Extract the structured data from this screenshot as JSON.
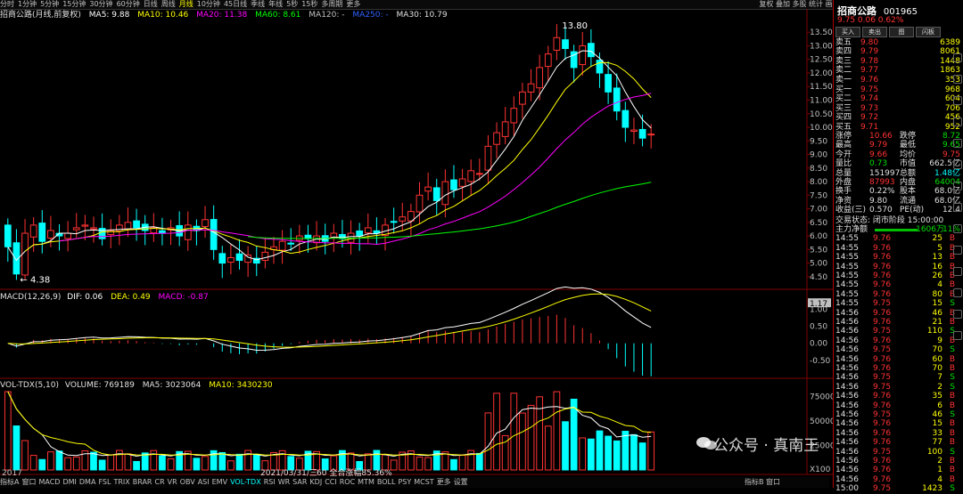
{
  "toolbar": {
    "periods": [
      "分时",
      "1分钟",
      "5分钟",
      "15分钟",
      "30分钟",
      "60分钟",
      "日线",
      "周线",
      "月线",
      "10分钟",
      "45日线",
      "季线",
      "年线",
      "5秒",
      "15秒",
      "多周期",
      "更多"
    ],
    "active_period": "月线",
    "right_items": "复权 叠加 多股 统计 画线 F10 标记 返回"
  },
  "chart_info": {
    "name": "招商公路(月线,前复权)",
    "ma5": "MA5: 9.88",
    "ma10": "MA10: 10.46",
    "ma20": "MA20: 11.38",
    "ma60": "MA60: 8.61",
    "ma120": "MA120: -",
    "ma250": "MA250: -",
    "ma30": "MA30: 10.79"
  },
  "price_axis": [
    "13.50",
    "13.00",
    "12.50",
    "12.00",
    "11.50",
    "11.00",
    "10.50",
    "10.00",
    "9.50",
    "9.00",
    "8.50",
    "8.00",
    "7.50",
    "7.00",
    "6.50",
    "6.00",
    "5.50",
    "5.00",
    "4.50"
  ],
  "annotations": {
    "high": "13.80",
    "low": "4.38"
  },
  "macd_info": {
    "label": "MACD(12,26,9)",
    "dif": "DIF: 0.06",
    "dea": "DEA: 0.49",
    "macd": "MACD: -0.87"
  },
  "macd_axis": [
    "1.17",
    "1.00",
    "0.50",
    "0.00",
    "-0.50"
  ],
  "vol_info": {
    "label": "VOL-TDX(5,10)",
    "volume": "VOLUME: 769189",
    "ma5": "MA5: 3023064",
    "ma10": "MA10: 3430230"
  },
  "vol_axis": [
    "75000",
    "50000",
    "25000",
    "X100"
  ],
  "time_axis": {
    "start": "2017",
    "mid": "2021/03/31/三",
    "overlay": "60 全合涨幅85.36%"
  },
  "bottom_tabs": [
    "指标A",
    "窗口",
    "MACD",
    "DMI",
    "DMA",
    "FSL",
    "TRIX",
    "BRAR",
    "CR",
    "VR",
    "OBV",
    "ASI",
    "EMV",
    "VOL-TDX",
    "RSI",
    "WR",
    "SAR",
    "KDJ",
    "CCI",
    "ROC",
    "MTM",
    "BOLL",
    "PSY",
    "MCST",
    "更多",
    "设置"
  ],
  "bottom_active": "VOL-TDX",
  "bottom_right": "指标B 窗口",
  "stock": {
    "name": "招商公路",
    "code": "001965",
    "price_line": "9.75  0.06  0.62%"
  },
  "trade_buttons": [
    "买入",
    "卖出",
    "图",
    "闪板"
  ],
  "order_book": [
    {
      "label": "卖五",
      "price": "9.80",
      "vol": "6389",
      "c": "red"
    },
    {
      "label": "卖四",
      "price": "9.79",
      "vol": "8061",
      "c": "red"
    },
    {
      "label": "卖三",
      "price": "9.78",
      "vol": "1448",
      "c": "red"
    },
    {
      "label": "卖二",
      "price": "9.77",
      "vol": "1863",
      "c": "red"
    },
    {
      "label": "卖一",
      "price": "9.76",
      "vol": "353",
      "c": "red"
    },
    {
      "label": "买一",
      "price": "9.75",
      "vol": "968",
      "c": "red"
    },
    {
      "label": "买二",
      "price": "9.74",
      "vol": "604",
      "c": "red"
    },
    {
      "label": "买三",
      "price": "9.73",
      "vol": "706",
      "c": "red"
    },
    {
      "label": "买四",
      "price": "9.72",
      "vol": "456",
      "c": "red"
    },
    {
      "label": "买五",
      "price": "9.71",
      "vol": "952",
      "c": "red"
    }
  ],
  "quote": [
    {
      "l1": "涨停",
      "v1": "10.66",
      "c1": "red",
      "l2": "跌停",
      "v2": "8.72",
      "c2": "green"
    },
    {
      "l1": "最高",
      "v1": "9.79",
      "c1": "red",
      "l2": "最低",
      "v2": "9.65",
      "c2": "green"
    },
    {
      "l1": "今开",
      "v1": "9.66",
      "c1": "red",
      "l2": "均价",
      "v2": "9.75",
      "c2": "red"
    },
    {
      "l1": "量比",
      "v1": "0.73",
      "c1": "green",
      "l2": "市值",
      "v2": "662.5亿",
      "c2": "white"
    },
    {
      "l1": "总量",
      "v1": "151997",
      "c1": "white",
      "l2": "总额",
      "v2": "1.48亿",
      "c2": "cyan"
    },
    {
      "l1": "外盘",
      "v1": "87993",
      "c1": "red",
      "l2": "内盘",
      "v2": "64004",
      "c2": "green"
    },
    {
      "l1": "换手",
      "v1": "0.22%",
      "c1": "white",
      "l2": "股本",
      "v2": "68.0亿",
      "c2": "white"
    },
    {
      "l1": "净资",
      "v1": "9.80",
      "c1": "white",
      "l2": "流通",
      "v2": "68.0亿",
      "c2": "white"
    },
    {
      "l1": "收益(三)",
      "v1": "0.570",
      "c1": "white",
      "l2": "PE(动)",
      "v2": "12.4",
      "c2": "white"
    }
  ],
  "status_line": "交易状态: 闭市阶段 15:00:00",
  "main_flow": {
    "label": "主力净额",
    "value": "-1606万",
    "pct": "11%"
  },
  "ticks": [
    {
      "t": "14:55",
      "p": "9.76",
      "v": "25",
      "d": "B"
    },
    {
      "t": "14:55",
      "p": "9.76",
      "v": "5",
      "d": "B"
    },
    {
      "t": "14:55",
      "p": "9.76",
      "v": "13",
      "d": "B"
    },
    {
      "t": "14:55",
      "p": "9.76",
      "v": "16",
      "d": "B"
    },
    {
      "t": "14:55",
      "p": "9.76",
      "v": "26",
      "d": "B"
    },
    {
      "t": "14:55",
      "p": "9.76",
      "v": "4",
      "d": "B"
    },
    {
      "t": "14:55",
      "p": "9.76",
      "v": "80",
      "d": "B"
    },
    {
      "t": "14:55",
      "p": "9.75",
      "v": "15",
      "d": "S"
    },
    {
      "t": "14:56",
      "p": "9.76",
      "v": "46",
      "d": "B"
    },
    {
      "t": "14:56",
      "p": "9.76",
      "v": "21",
      "d": "B"
    },
    {
      "t": "14:56",
      "p": "9.75",
      "v": "110",
      "d": "S"
    },
    {
      "t": "14:56",
      "p": "9.76",
      "v": "9",
      "d": "B"
    },
    {
      "t": "14:56",
      "p": "9.75",
      "v": "70",
      "d": "S"
    },
    {
      "t": "14:56",
      "p": "9.76",
      "v": "60",
      "d": "B"
    },
    {
      "t": "14:56",
      "p": "9.76",
      "v": "70",
      "d": "B"
    },
    {
      "t": "14:56",
      "p": "9.75",
      "v": "7",
      "d": "S"
    },
    {
      "t": "14:56",
      "p": "9.75",
      "v": "2",
      "d": "S"
    },
    {
      "t": "14:56",
      "p": "9.76",
      "v": "35",
      "d": "B"
    },
    {
      "t": "14:56",
      "p": "9.76",
      "v": "6",
      "d": "B"
    },
    {
      "t": "14:56",
      "p": "9.75",
      "v": "46",
      "d": "S"
    },
    {
      "t": "14:56",
      "p": "9.76",
      "v": "15",
      "d": "B"
    },
    {
      "t": "14:56",
      "p": "9.76",
      "v": "33",
      "d": "B"
    },
    {
      "t": "14:56",
      "p": "9.76",
      "v": "77",
      "d": "B"
    },
    {
      "t": "14:56",
      "p": "9.75",
      "v": "100",
      "d": "S"
    },
    {
      "t": "14:56",
      "p": "9.76",
      "v": "2",
      "d": "B"
    },
    {
      "t": "14:56",
      "p": "9.76",
      "v": "1",
      "d": "B"
    },
    {
      "t": "14:56",
      "p": "9.76",
      "v": "4",
      "d": "B"
    },
    {
      "t": "15:00",
      "p": "9.75",
      "v": "1423",
      "d": "S"
    }
  ],
  "watermark": "公众号 · 真南王",
  "colors": {
    "up": "#ff3232",
    "down": "#00ffff",
    "ma5": "#ffffff",
    "ma10": "#ffff00",
    "ma20": "#ff00ff",
    "ma60": "#00ff00",
    "dif": "#ffffff",
    "dea": "#ffff00"
  },
  "chart_data": {
    "type": "candlestick",
    "title": "招商公路(月线,前复权)",
    "period": "monthly",
    "approx_close_series": [
      5.6,
      4.6,
      6.1,
      6.4,
      5.8,
      6.2,
      6.0,
      6.1,
      6.3,
      6.4,
      6.3,
      5.9,
      6.2,
      6.4,
      6.5,
      6.3,
      6.2,
      6.3,
      6.1,
      6.3,
      6.0,
      6.4,
      6.2,
      6.6,
      5.5,
      5.0,
      5.2,
      5.1,
      5.3,
      5.0,
      5.4,
      5.6,
      5.8,
      5.7,
      6.0,
      5.9,
      6.0,
      5.8,
      6.1,
      5.9,
      6.1,
      6.0,
      6.3,
      6.1,
      6.4,
      6.5,
      6.7,
      6.9,
      7.5,
      7.8,
      7.3,
      8.0,
      7.7,
      8.1,
      8.4,
      8.3,
      9.3,
      9.8,
      10.2,
      10.7,
      11.3,
      11.6,
      12.2,
      12.7,
      13.3,
      12.9,
      12.2,
      13.0,
      12.6,
      12.0,
      11.3,
      10.6,
      10.0,
      9.9,
      9.6,
      9.75
    ],
    "high": 13.8,
    "low": 4.38,
    "ma": {
      "MA5": 9.88,
      "MA10": 10.46,
      "MA20": 11.38,
      "MA30": 10.79,
      "MA60": 8.61
    },
    "macd": {
      "DIF": 0.06,
      "DEA": 0.49,
      "MACD": -0.87
    },
    "volume": {
      "VOLUME": 769189,
      "MA5": 3023064,
      "MA10": 3430230
    },
    "ylim": [
      4.2,
      13.9
    ]
  }
}
